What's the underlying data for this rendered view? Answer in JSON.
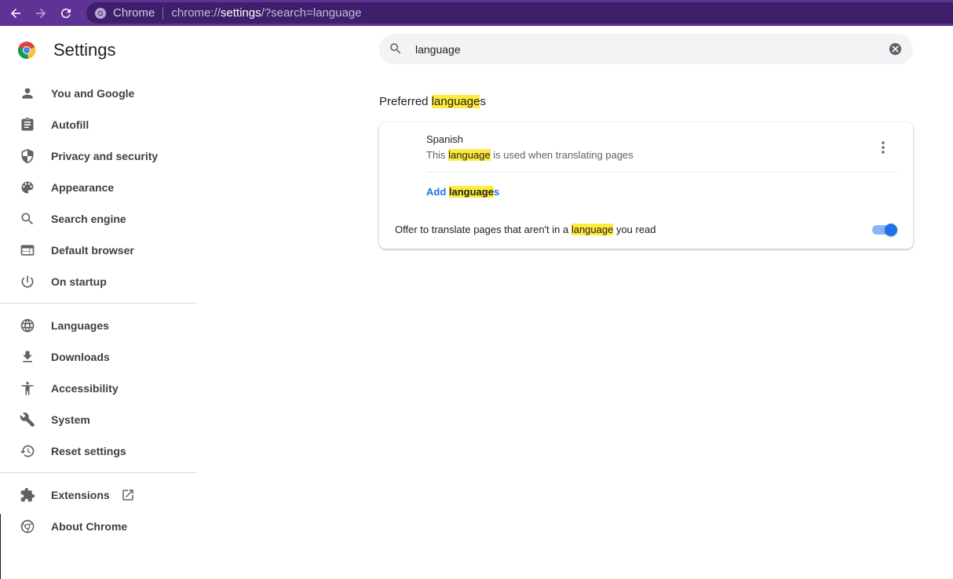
{
  "browser": {
    "chip_label": "Chrome",
    "url_scheme": "chrome://",
    "url_host": "settings",
    "url_rest": "/?search=language",
    "theme_color": "#5f3396"
  },
  "app": {
    "title": "Settings"
  },
  "search": {
    "value": "language",
    "placeholder": "Search settings"
  },
  "sidebar": {
    "items": [
      {
        "label": "You and Google",
        "icon": "person-icon"
      },
      {
        "label": "Autofill",
        "icon": "clipboard-icon"
      },
      {
        "label": "Privacy and security",
        "icon": "shield-icon"
      },
      {
        "label": "Appearance",
        "icon": "palette-icon"
      },
      {
        "label": "Search engine",
        "icon": "search-icon"
      },
      {
        "label": "Default browser",
        "icon": "browser-window-icon"
      },
      {
        "label": "On startup",
        "icon": "power-icon"
      },
      {
        "label": "Languages",
        "icon": "globe-icon"
      },
      {
        "label": "Downloads",
        "icon": "download-icon"
      },
      {
        "label": "Accessibility",
        "icon": "accessibility-icon"
      },
      {
        "label": "System",
        "icon": "wrench-icon"
      },
      {
        "label": "Reset settings",
        "icon": "history-icon"
      },
      {
        "label": "Extensions",
        "icon": "puzzle-icon"
      },
      {
        "label": "About Chrome",
        "icon": "chrome-icon"
      }
    ]
  },
  "content": {
    "section": {
      "prefix": "Preferred ",
      "highlight": "language",
      "suffix": "s"
    },
    "language": {
      "name": "Spanish",
      "desc_prefix": "This ",
      "desc_highlight": "language",
      "desc_suffix": " is used when translating pages"
    },
    "add_languages": {
      "prefix": "Add ",
      "highlight": "language",
      "suffix": "s"
    },
    "offer_translate": {
      "prefix": "Offer to translate pages that aren't in a ",
      "highlight": "language",
      "suffix": " you read",
      "enabled": true
    }
  }
}
